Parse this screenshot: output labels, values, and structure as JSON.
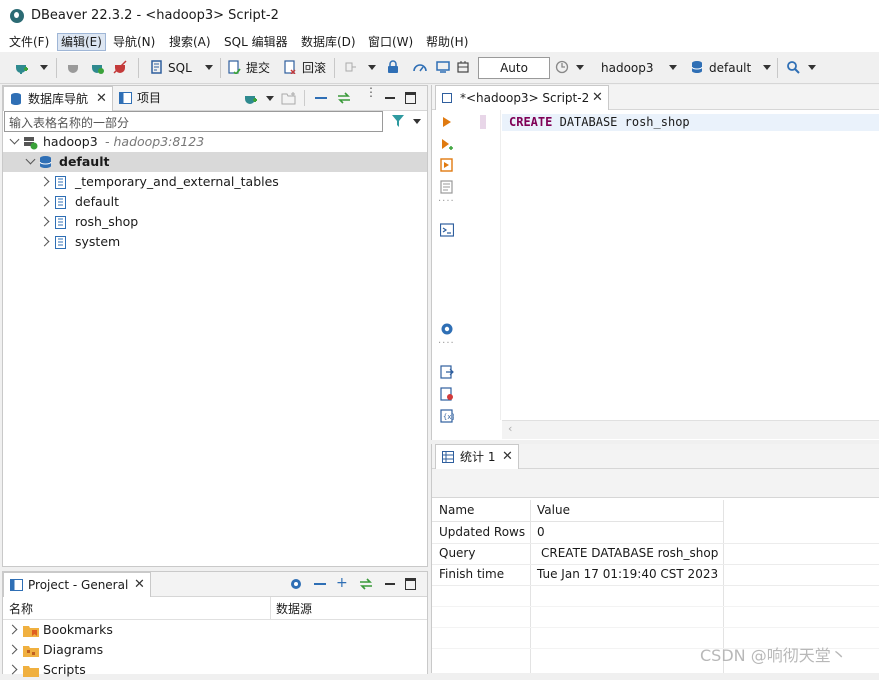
{
  "window": {
    "title": "DBeaver 22.3.2 - <hadoop3> Script-2"
  },
  "menu": [
    "文件(F)",
    "编辑(E)",
    "导航(N)",
    "搜索(A)",
    "SQL 编辑器",
    "数据库(D)",
    "窗口(W)",
    "帮助(H)"
  ],
  "toolbar": {
    "sql_label": "SQL",
    "commit_label": "提交",
    "rollback_label": "回滚",
    "auto_label": "Auto",
    "connection_label": "hadoop3",
    "schema_label": "default"
  },
  "navigator": {
    "tab_label": "数据库导航",
    "projects_tab_label": "项目",
    "filter_placeholder": "输入表格名称的一部分",
    "connection": {
      "name": "hadoop3",
      "address": "- hadoop3:8123"
    },
    "database": "default",
    "tables": [
      "_temporary_and_external_tables",
      "default",
      "rosh_shop",
      "system"
    ]
  },
  "project": {
    "tab_label": "Project - General",
    "col_name": "名称",
    "col_source": "数据源",
    "items": [
      "Bookmarks",
      "Diagrams",
      "Scripts"
    ]
  },
  "editor": {
    "tab_label": "*<hadoop3> Script-2",
    "sql_keyword1": "CREATE",
    "sql_keyword2": "DATABASE",
    "sql_ident": "rosh_shop"
  },
  "results": {
    "tab_label": "统计 1",
    "col_name": "Name",
    "col_value": "Value",
    "rows": [
      {
        "name": "Updated Rows",
        "value": "0"
      },
      {
        "name": "Query",
        "value": "CREATE DATABASE rosh_shop"
      },
      {
        "name": "Finish time",
        "value": "Tue Jan 17 01:19:40 CST 2023"
      }
    ]
  },
  "watermark": "CSDN @响彻天堂丶"
}
